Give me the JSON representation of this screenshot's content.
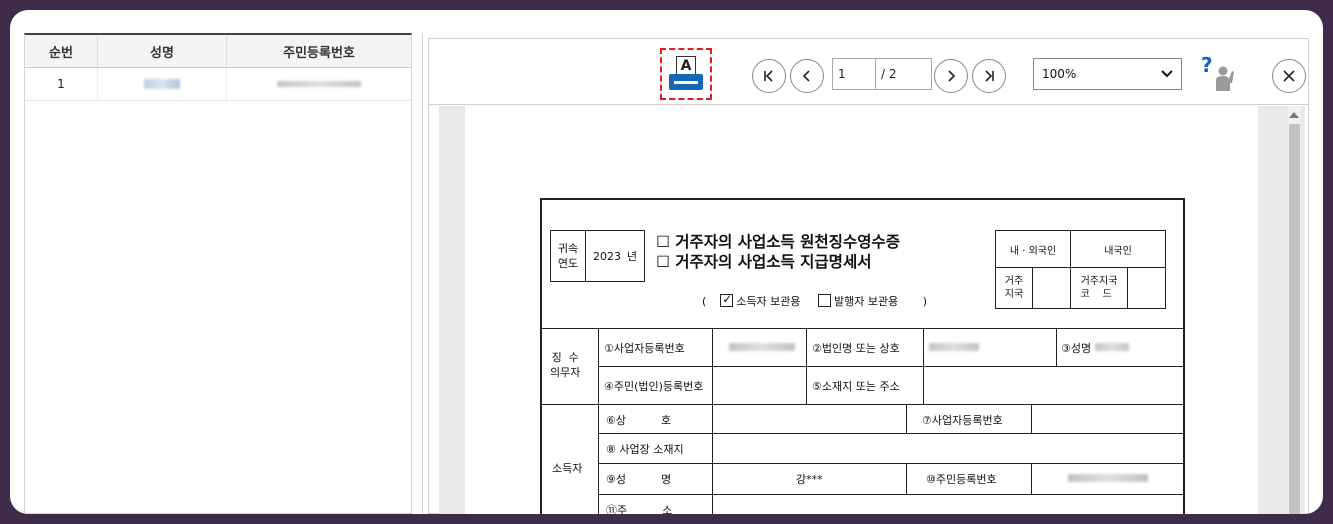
{
  "left_table": {
    "headers": [
      "순번",
      "성명",
      "주민등록번호"
    ],
    "rows": [
      {
        "no": "1"
      }
    ]
  },
  "toolbar": {
    "print_icon_letter": "A",
    "first_page": "|<",
    "prev_page": "<",
    "current_page": "1",
    "total_pages": "/ 2",
    "next_page": ">",
    "last_page": ">|",
    "zoom_value": "100%",
    "help_mark": "?",
    "close_label": "×"
  },
  "form": {
    "year_label": "귀속\n연도",
    "year_value": "2023",
    "year_suffix": "년",
    "title_line1": "☐ 거주자의 사업소득 원천징수영수증",
    "title_line2": "☐ 거주자의 사업소득 지급명세서",
    "nationality_label": "내 · 외국인",
    "nationality_value": "내국인",
    "residence_label": "거주\n지국",
    "residence_code_label": "거주지국\n코    드",
    "open_paren": "(",
    "close_paren": ")",
    "copy_holder": "소득자 보관용",
    "copy_issuer": "발행자 보관용",
    "withholder_label": "징  수\n의무자",
    "f1": "①사업자등록번호",
    "f2": "②법인명 또는 상호",
    "f3": "③성명",
    "f4": "④주민(법인)등록번호",
    "f5": "⑤소재지 또는 주소",
    "earner_label": "소득자",
    "f6": "⑥상          호",
    "f7": "⑦사업자등록번호",
    "f8": "⑧ 사업장 소재지",
    "f9": "⑨성          명",
    "f9_value": "강***",
    "f10": "⑩주민등록번호",
    "f11": "⑪주          소"
  }
}
